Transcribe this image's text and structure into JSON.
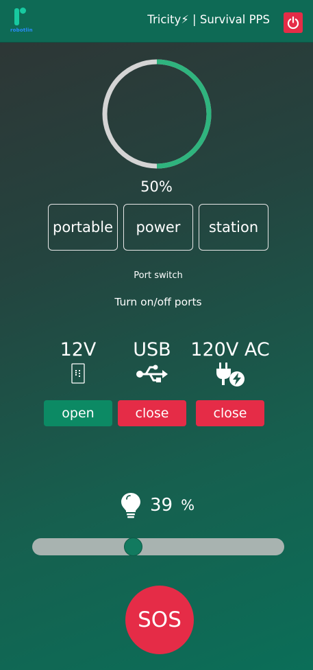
{
  "header": {
    "logo_text": "robotlin",
    "title": "Tricity⚡ | Survival PPS",
    "power_icon": "power-icon"
  },
  "battery": {
    "percent_label": "50%",
    "level": 0.5,
    "fill_color": "#2fb47e",
    "track_color": "#d4d4d4"
  },
  "words": [
    "portable",
    "power",
    "station"
  ],
  "port_switch_title": "Port switch",
  "port_caption": "Turn on/off ports",
  "ports": [
    {
      "label": "12V",
      "icon": "port-12v-icon",
      "button": "open",
      "state_color": "#0c8a64"
    },
    {
      "label": "USB",
      "icon": "usb-icon",
      "button": "close",
      "state_color": "#e52c47"
    },
    {
      "label": "120V AC",
      "icon": "ac-plug-icon",
      "button": "close",
      "state_color": "#e52c47"
    }
  ],
  "brightness": {
    "icon": "lightbulb-icon",
    "value": "39",
    "unit": "%",
    "level": 0.39
  },
  "sos_label": "SOS",
  "colors": {
    "accent": "#0e6a55",
    "danger": "#e52c47",
    "success": "#0c8a64"
  }
}
